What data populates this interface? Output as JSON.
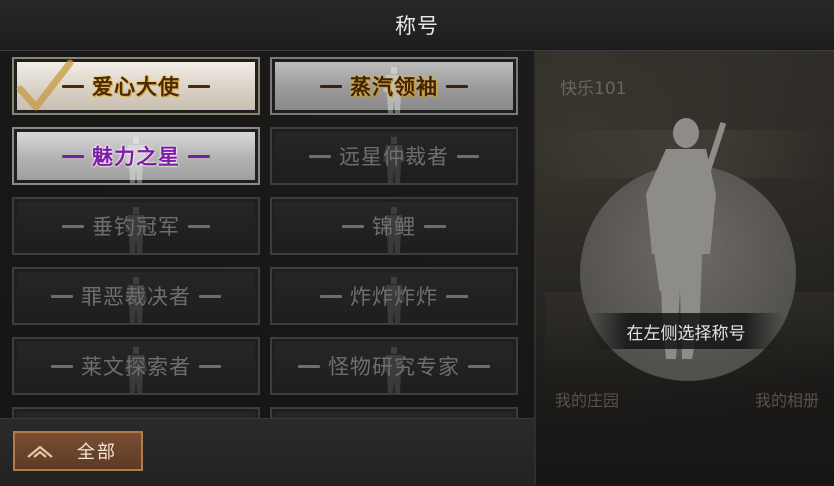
{
  "header": {
    "title": "称号"
  },
  "background": {
    "player_name": "快乐101",
    "link_left": "我的庄园",
    "link_right": "我的相册"
  },
  "titles": [
    {
      "label": "爱心大使",
      "style": "gold",
      "selected": true
    },
    {
      "label": "蒸汽领袖",
      "style": "silver",
      "selected": false
    },
    {
      "label": "魅力之星",
      "style": "purple",
      "selected": false
    },
    {
      "label": "远星仲裁者",
      "style": "locked",
      "selected": false
    },
    {
      "label": "垂钓冠军",
      "style": "locked",
      "selected": false
    },
    {
      "label": "锦鲤",
      "style": "locked",
      "selected": false
    },
    {
      "label": "罪恶裁决者",
      "style": "locked",
      "selected": false
    },
    {
      "label": "炸炸炸炸",
      "style": "locked",
      "selected": false
    },
    {
      "label": "莱文探索者",
      "style": "locked",
      "selected": false
    },
    {
      "label": "怪物研究专家",
      "style": "locked",
      "selected": false
    }
  ],
  "filter": {
    "label": "全部",
    "icon": "chevron-up-double-icon"
  },
  "preview": {
    "hint": "在左侧选择称号"
  },
  "colors": {
    "accent_brown": "#7a4e33",
    "gold_text": "#4a2a06",
    "purple_text": "#7e1ea8"
  }
}
